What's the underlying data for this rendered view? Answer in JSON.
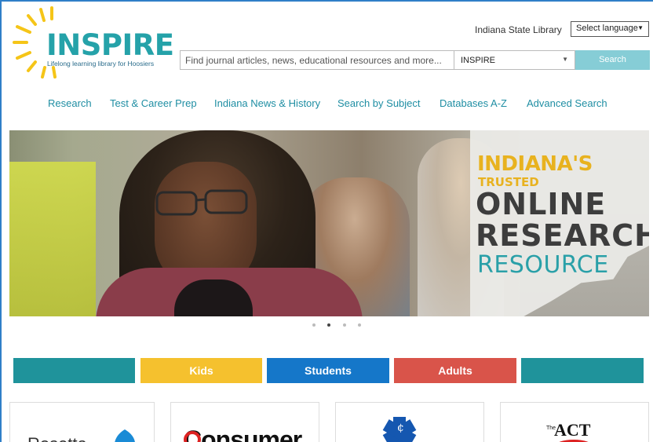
{
  "header": {
    "logo_word": "INSPIRE",
    "logo_tagline": "Lifelong learning library for Hoosiers",
    "state_library": "Indiana State Library",
    "language_select": "Select language",
    "search_placeholder": "Find journal articles, news, educational resources and more...",
    "search_scope": "INSPIRE",
    "search_button": "Search",
    "colors": {
      "brand": "#25a2a9",
      "accent_yellow": "#f5c518",
      "search_button": "#86cdd6"
    }
  },
  "nav": {
    "items": [
      {
        "label": "Research"
      },
      {
        "label": "Test & Career Prep"
      },
      {
        "label": "Indiana News & History"
      },
      {
        "label": "Search by Subject"
      },
      {
        "label": "Databases A-Z"
      },
      {
        "label": "Advanced Search"
      }
    ]
  },
  "hero": {
    "line1": "INDIANA'S",
    "line2": "TRUSTED",
    "line3": "ONLINE",
    "line4": "RESEARCH",
    "line5": "RESOURCE",
    "active_slide": 2,
    "slide_count": 4
  },
  "audience": {
    "tabs": [
      {
        "label": "",
        "color": "#1f939b"
      },
      {
        "label": "Kids",
        "color": "#f5c12e"
      },
      {
        "label": "Students",
        "color": "#1577c9"
      },
      {
        "label": "Adults",
        "color": "#d9544a"
      },
      {
        "label": "",
        "color": "#1f939b"
      }
    ]
  },
  "cards": [
    {
      "label": "Rosetta"
    },
    {
      "label": "Consumer"
    },
    {
      "label": "medical-star-icon"
    },
    {
      "label": "ACT",
      "prefix": "The"
    }
  ]
}
